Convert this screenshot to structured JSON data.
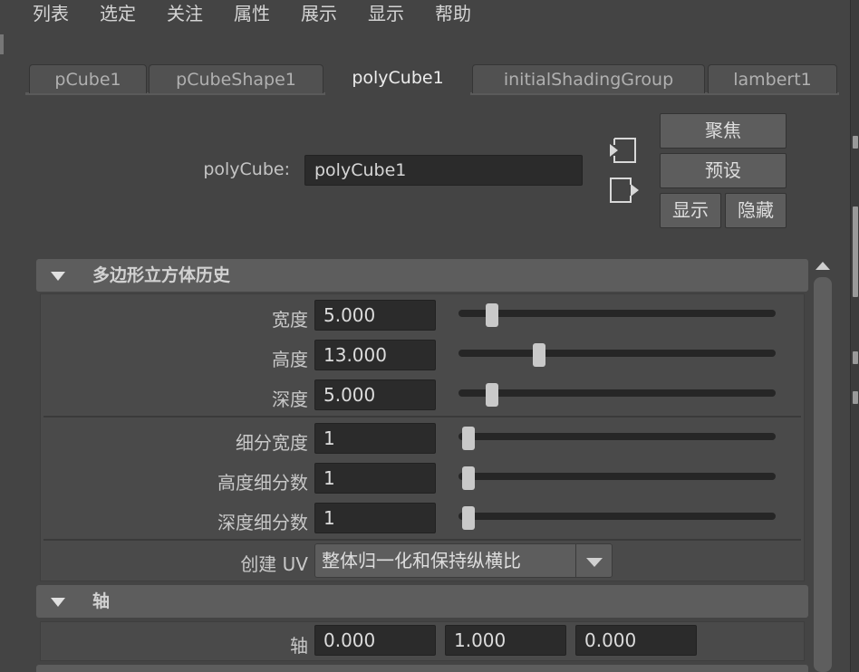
{
  "menu": [
    "列表",
    "选定",
    "关注",
    "属性",
    "展示",
    "显示",
    "帮助"
  ],
  "tabs": [
    {
      "label": "pCube1",
      "active": false
    },
    {
      "label": "pCubeShape1",
      "active": false
    },
    {
      "label": "polyCube1",
      "active": true
    },
    {
      "label": "initialShadingGroup",
      "active": false
    },
    {
      "label": "lambert1",
      "active": false
    }
  ],
  "node": {
    "label": "polyCube:",
    "value": "polyCube1"
  },
  "buttons": {
    "focus": "聚焦",
    "presets": "预设",
    "show": "显示",
    "hide": "隐藏"
  },
  "icons": {
    "load_attributes": "enter-arrow-icon",
    "copy_tab": "exit-arrow-icon"
  },
  "sections": {
    "history": {
      "title": "多边形立方体历史",
      "rows": [
        {
          "label": "宽度",
          "value": "5.000",
          "slider": 0.077
        },
        {
          "label": "高度",
          "value": "13.000",
          "slider": 0.231
        },
        {
          "label": "深度",
          "value": "5.000",
          "slider": 0.077
        },
        {
          "label": "细分宽度",
          "value": "1",
          "slider": 0.0
        },
        {
          "label": "高度细分数",
          "value": "1",
          "slider": 0.0
        },
        {
          "label": "深度细分数",
          "value": "1",
          "slider": 0.0
        }
      ],
      "uv": {
        "label": "创建 UV",
        "value": "整体归一化和保持纵横比"
      }
    },
    "axis": {
      "title": "轴",
      "label": "轴",
      "values": [
        "0.000",
        "1.000",
        "0.000"
      ]
    }
  },
  "colors": {
    "background": "#444444",
    "field": "#2b2b2b",
    "header": "#5d5d5d",
    "thumb": "#c9c9c9"
  }
}
